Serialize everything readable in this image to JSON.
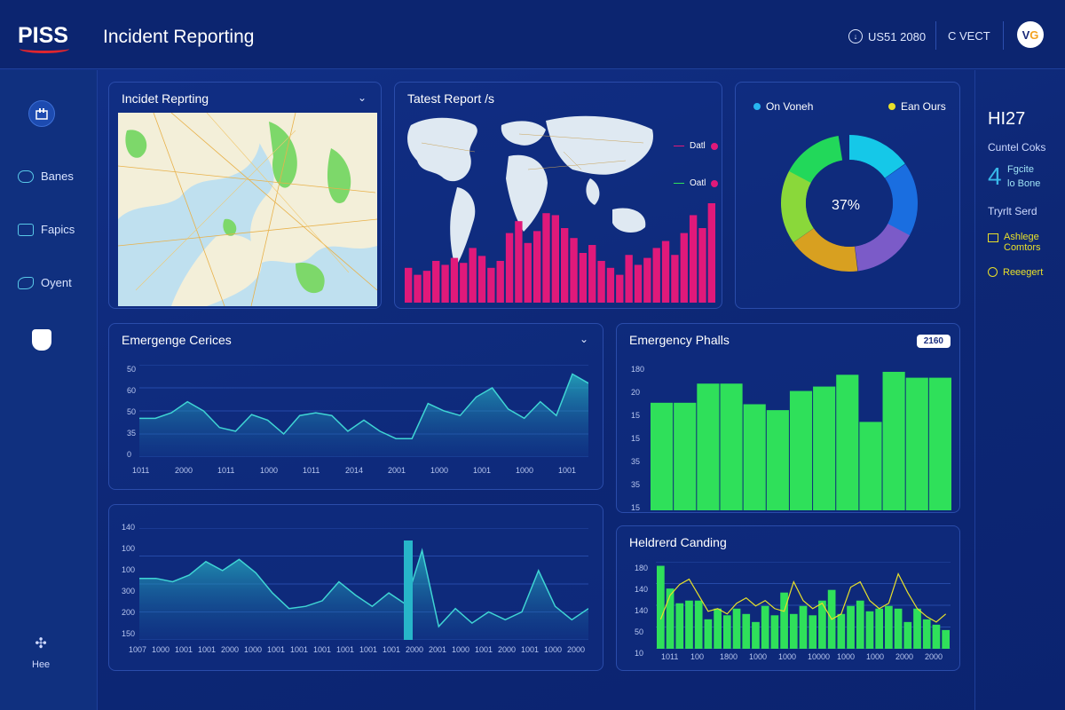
{
  "header": {
    "logo": "PISS",
    "title": "Incident Reporting",
    "info": "US51 2080",
    "action": "C VECT",
    "avatar": "V",
    "avatar_accent": "G"
  },
  "sidebar": {
    "items": [
      {
        "label": "Banes",
        "icon": "link-icon"
      },
      {
        "label": "Fapics",
        "icon": "folder-icon"
      },
      {
        "label": "Oyent",
        "icon": "chart-icon"
      }
    ],
    "help": "Hee"
  },
  "panels": {
    "map": {
      "title": "Incidet Reprting"
    },
    "world": {
      "title": "Tatest Report /s",
      "legend": [
        "Datl",
        "Oatl"
      ],
      "bar_values": [
        35,
        28,
        32,
        42,
        38,
        45,
        40,
        55,
        47,
        35,
        42,
        70,
        82,
        60,
        72,
        90,
        88,
        75,
        65,
        50,
        58,
        42,
        35,
        28,
        48,
        38,
        45,
        55,
        62,
        48,
        70,
        88,
        75,
        100
      ]
    },
    "donut": {
      "legend": [
        "On Voneh",
        "Ean Ours"
      ],
      "center": "37%"
    },
    "line1": {
      "title": "Emergenge Cerices",
      "y_ticks": [
        "50",
        "60",
        "50",
        "35",
        "0"
      ],
      "x_ticks": [
        "1011",
        "2000",
        "1011",
        "1000",
        "1011",
        "2014",
        "2001",
        "1000",
        "1001",
        "1000",
        "1001"
      ],
      "values": [
        42,
        42,
        48,
        60,
        50,
        32,
        28,
        46,
        40,
        25,
        45,
        48,
        45,
        28,
        40,
        28,
        20,
        20,
        58,
        50,
        45,
        65,
        75,
        52,
        42,
        60,
        45,
        90,
        80
      ]
    },
    "bars2": {
      "title": "Emergency Phalls",
      "badge": "2160",
      "y_ticks": [
        "180",
        "20",
        "15",
        "15",
        "35",
        "35",
        "15"
      ],
      "values": [
        73,
        73,
        86,
        86,
        72,
        68,
        81,
        84,
        92,
        60,
        94,
        90,
        90
      ]
    },
    "line2": {
      "y_ticks": [
        "140",
        "100",
        "100",
        "300",
        "200",
        "150"
      ],
      "x_ticks": [
        "1007",
        "1000",
        "1001",
        "1001",
        "2000",
        "1000",
        "1001",
        "1001",
        "1001",
        "1001",
        "1001",
        "1001",
        "2000",
        "2001",
        "1000",
        "1001",
        "2000",
        "1001",
        "1000",
        "2000"
      ],
      "values": [
        55,
        55,
        52,
        58,
        70,
        62,
        72,
        60,
        42,
        28,
        30,
        35,
        52,
        40,
        30,
        42,
        32,
        80,
        12,
        28,
        15,
        25,
        18,
        25,
        62,
        30,
        18,
        28
      ]
    },
    "bars3": {
      "title": "Heldrerd Canding",
      "y_ticks": [
        "180",
        "140",
        "140",
        "50",
        "10"
      ],
      "x_ticks": [
        "1011",
        "100",
        "1800",
        "1000",
        "1000",
        "10000",
        "1000",
        "1000",
        "2000",
        "2000"
      ],
      "bar_values": [
        62,
        45,
        34,
        36,
        36,
        22,
        30,
        25,
        30,
        26,
        20,
        32,
        25,
        42,
        26,
        32,
        25,
        36,
        44,
        26,
        32,
        36,
        28,
        30,
        32,
        30,
        20,
        30,
        22,
        18,
        14
      ],
      "line_values": [
        22,
        40,
        48,
        52,
        40,
        28,
        30,
        26,
        34,
        38,
        32,
        36,
        30,
        28,
        50,
        36,
        30,
        34,
        22,
        26,
        46,
        50,
        36,
        30,
        34,
        56,
        42,
        30,
        24,
        20,
        26
      ]
    }
  },
  "right_rail": {
    "number": "HI27",
    "label1": "Cuntel Coks",
    "digit": "4",
    "sub1": "Fgcite",
    "sub2": "lo Bone",
    "label2": "Tryrlt Serd",
    "item1a": "Ashlege",
    "item1b": "Comtors",
    "item2": "Reeegert"
  },
  "colors": {
    "accent_pink": "#e0197a",
    "accent_green": "#2fe05a",
    "accent_yellow": "#e8e02a",
    "teal": "#27b6c9"
  }
}
